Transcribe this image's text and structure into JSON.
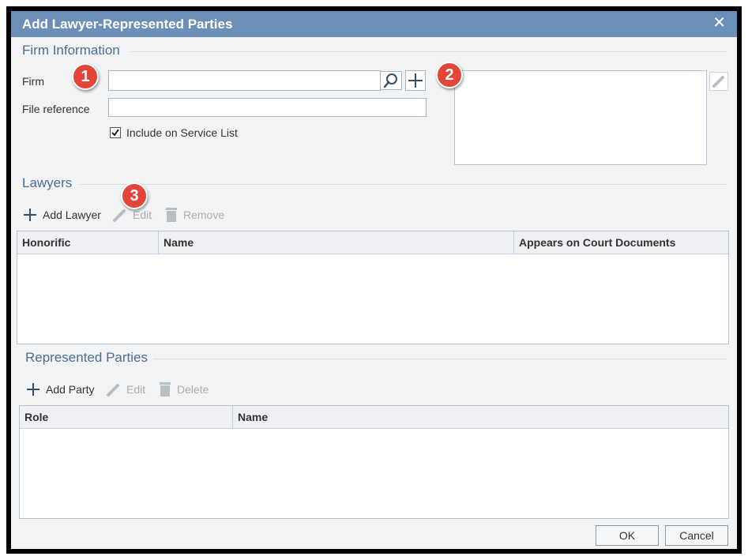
{
  "dialog": {
    "title": "Add Lawyer-Represented Parties",
    "close_glyph": "✕"
  },
  "firm_section": {
    "title": "Firm Information",
    "firm_label": "Firm",
    "firm_value": "",
    "file_reference_label": "File reference",
    "file_reference_value": "",
    "include_service_list_label": "Include on Service List",
    "include_service_list_checked": true
  },
  "lawyers_section": {
    "title": "Lawyers",
    "toolbar": {
      "add_label": "Add Lawyer",
      "edit_label": "Edit",
      "remove_label": "Remove"
    },
    "columns": [
      "Honorific",
      "Name",
      "Appears on Court Documents"
    ]
  },
  "parties_section": {
    "title": "Represented Parties",
    "toolbar": {
      "add_label": "Add Party",
      "edit_label": "Edit",
      "delete_label": "Delete"
    },
    "columns": [
      "Role",
      "Name"
    ]
  },
  "footer": {
    "ok_label": "OK",
    "cancel_label": "Cancel"
  },
  "callouts": [
    "1",
    "2",
    "3"
  ],
  "colors": {
    "titlebar": "#6b8fb7",
    "section_heading": "#4d6e92",
    "callout": "#e3453b",
    "accent_icon": "#2f4f73"
  }
}
